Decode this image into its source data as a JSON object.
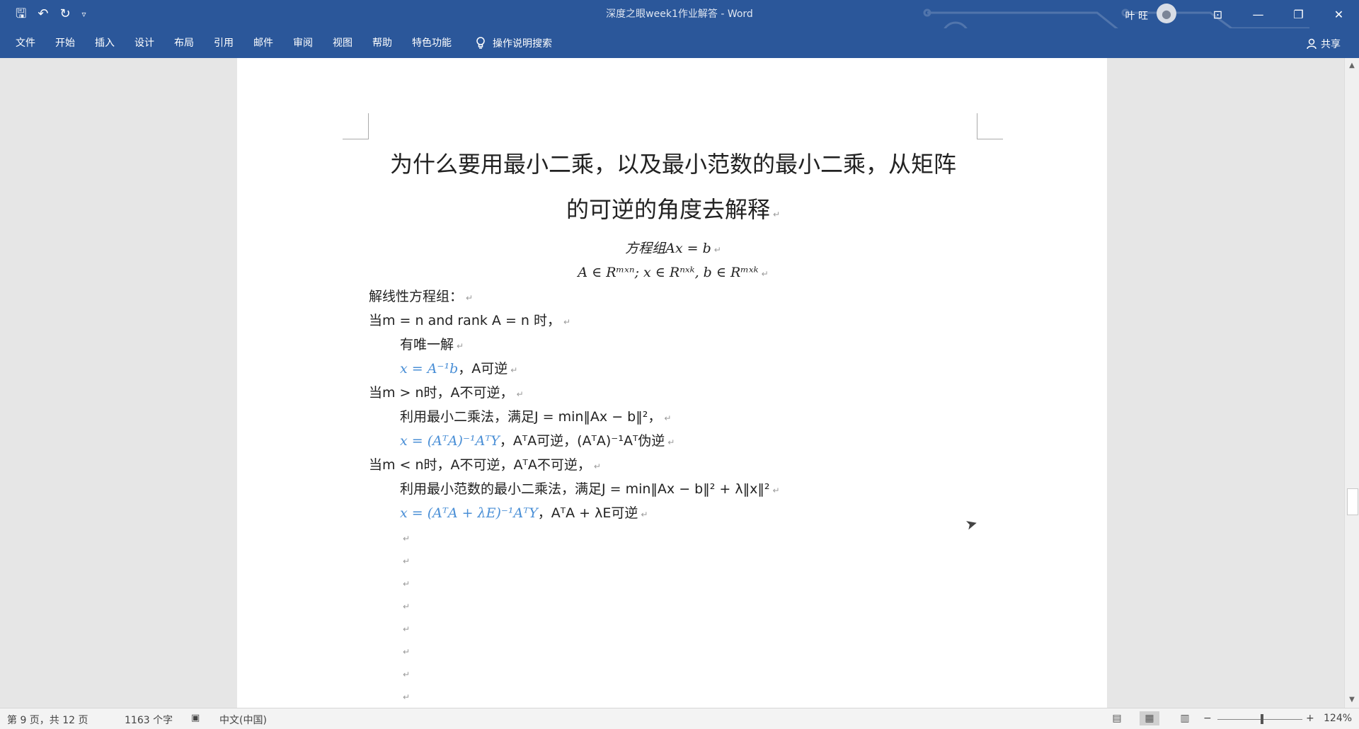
{
  "window": {
    "title": "深度之眼week1作业解答  -  Word",
    "user_name": "叶 旺"
  },
  "qat": {
    "save": "🖫",
    "undo": "↶",
    "redo": "↻",
    "more": "▿"
  },
  "window_controls": {
    "ribbon_display": "⊡",
    "minimize": "—",
    "restore": "❐",
    "close": "✕"
  },
  "ribbon": {
    "tabs": [
      "文件",
      "开始",
      "插入",
      "设计",
      "布局",
      "引用",
      "邮件",
      "审阅",
      "视图",
      "帮助",
      "特色功能"
    ],
    "tell_me": "操作说明搜索",
    "share": "共享"
  },
  "document": {
    "heading_line1": "为什么要用最小二乘，以及最小范数的最小二乘，从矩阵",
    "heading_line2": "的可逆的角度去解释",
    "eq1": "方程组Ax = b",
    "eq2": "A ∈ Rᵐˣⁿ; x ∈ Rⁿˣᵏ, b ∈ Rᵐˣᵏ",
    "p1": "解线性方程组：",
    "p2": "当m = n  and rank A = n 时，",
    "p3": "有唯一解",
    "p4_formula": "x = A⁻¹b",
    "p4_rest": "，A可逆",
    "p5": "当m > n时，A不可逆，",
    "p6": "利用最小二乘法，满足J = min‖Ax − b‖²，",
    "p7_formula": "x = (AᵀA)⁻¹AᵀY",
    "p7_rest": "，AᵀA可逆，(AᵀA)⁻¹Aᵀ伪逆",
    "p8": "当m < n时，A不可逆，AᵀA不可逆，",
    "p9": "利用最小范数的最小二乘法，满足J = min‖Ax − b‖² + λ‖x‖²",
    "p10_formula": "x = (AᵀA + λE)⁻¹AᵀY",
    "p10_rest": "，AᵀA + λE可逆",
    "para_mark": "↵"
  },
  "status": {
    "page": "第 9 页，共 12 页",
    "words": "1163 个字",
    "language": "中文(中国)",
    "zoom": "124%",
    "zoom_minus": "−",
    "zoom_plus": "+"
  },
  "colors": {
    "ribbon": "#2b579a",
    "formula": "#4a8fd6"
  }
}
